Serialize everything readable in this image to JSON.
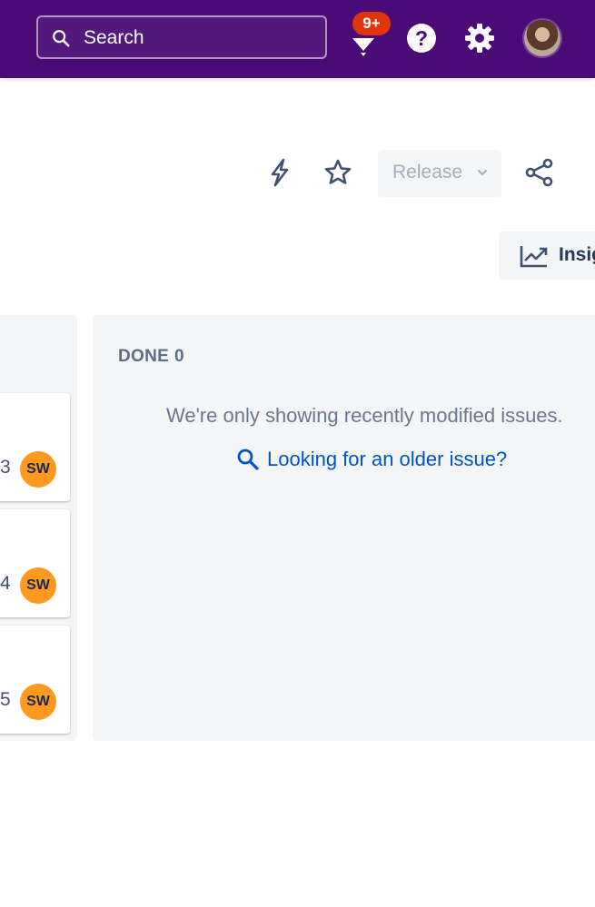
{
  "topbar": {
    "search_placeholder": "Search",
    "notifications_badge": "9+",
    "icons": [
      "search-icon",
      "notifications-icon",
      "help-icon",
      "settings-icon",
      "user-avatar"
    ],
    "background_color": "#4a0b77",
    "badge_color": "#de350b"
  },
  "header_actions": {
    "release_label": "Release",
    "icons": [
      "automation-icon",
      "star-icon",
      "share-icon"
    ]
  },
  "insights": {
    "label": "Insig"
  },
  "board": {
    "cards": [
      {
        "number": "3",
        "assignee_initials": "SW"
      },
      {
        "number": "4",
        "assignee_initials": "SW"
      },
      {
        "number": "5",
        "assignee_initials": "SW"
      }
    ],
    "done_column": {
      "title": "DONE",
      "count": "0",
      "message": "We're only showing recently modified issues.",
      "older_issue_link": "Looking for an older issue?"
    }
  },
  "colors": {
    "link": "#0052cc",
    "column_bg": "#f4f5f7",
    "avatar_orange": "#ff991f"
  }
}
